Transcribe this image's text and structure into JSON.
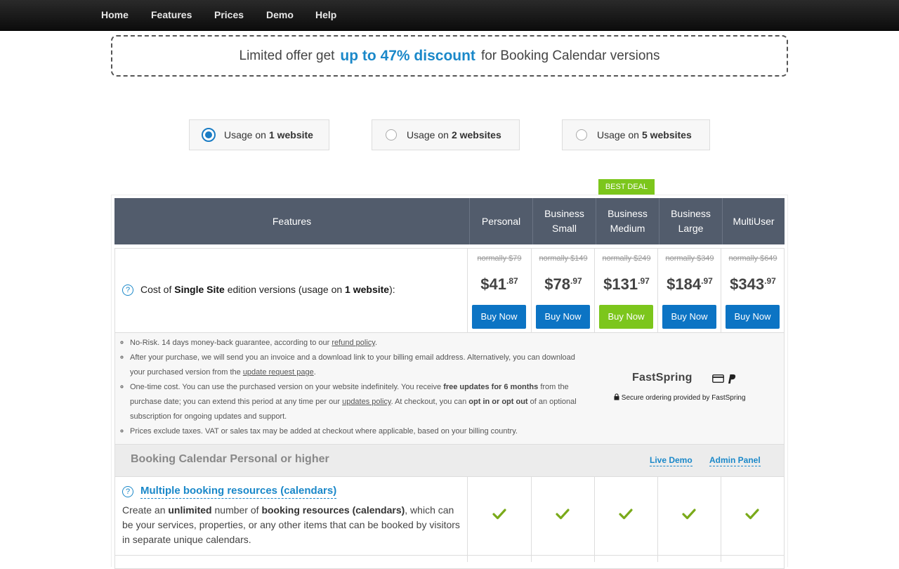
{
  "nav": {
    "items": [
      "Home",
      "Features",
      "Prices",
      "Demo",
      "Help"
    ]
  },
  "promo": {
    "prefix": "Limited offer get",
    "highlight": "up to 47% discount",
    "suffix": "for Booking Calendar versions"
  },
  "usage": {
    "options": [
      {
        "prefix": "Usage on",
        "bold": "1 website",
        "selected": true
      },
      {
        "prefix": "Usage on",
        "bold": "2 websites",
        "selected": false
      },
      {
        "prefix": "Usage on",
        "bold": "5 websites",
        "selected": false
      }
    ]
  },
  "badge": "BEST DEAL",
  "table": {
    "headers": {
      "features": "Features",
      "personal": "Personal",
      "business_small": "Business Small",
      "business_medium": "Business Medium",
      "business_large": "Business Large",
      "multiuser": "MultiUser"
    },
    "cost": {
      "label_prefix": "Cost of",
      "label_bold1": "Single Site",
      "label_mid": "edition versions (usage on",
      "label_bold2": "1 website",
      "label_suffix": "):",
      "plans": [
        {
          "normally": "normally $79",
          "dollars": "$41",
          "cents": ".87",
          "buy": "Buy Now"
        },
        {
          "normally": "normally $149",
          "dollars": "$78",
          "cents": ".97",
          "buy": "Buy Now"
        },
        {
          "normally": "normally $249",
          "dollars": "$131",
          "cents": ".97",
          "buy": "Buy Now"
        },
        {
          "normally": "normally $349",
          "dollars": "$184",
          "cents": ".97",
          "buy": "Buy Now"
        },
        {
          "normally": "normally $649",
          "dollars": "$343",
          "cents": ".97",
          "buy": "Buy Now"
        }
      ]
    },
    "info": {
      "item1_text": "No-Risk. 14 days money-back guarantee, according to our",
      "item1_link": "refund policy",
      "item2_text": "After your purchase, we will send you an invoice and a download link to your billing email address. Alternatively, you can download your purchased version from the",
      "item2_link": "update request page",
      "item3_a": "One-time cost. You can use the purchased version on your website indefinitely. You receive",
      "item3_bold1": "free updates for 6 months",
      "item3_b": "from the purchase date; you can extend this period at any time per our",
      "item3_link": "updates policy",
      "item3_c": ". At checkout, you can",
      "item3_bold2": "opt in or opt out",
      "item3_d": "of an optional subscription for ongoing updates and support.",
      "item4_text": "Prices exclude taxes. VAT or sales tax may be added at checkout where applicable, based on your billing country.",
      "fastspring": "FastSpring",
      "secure": "Secure ordering provided by FastSpring"
    },
    "section": {
      "title": "Booking Calendar Personal or higher",
      "live_demo": "Live Demo",
      "admin_panel": "Admin Panel"
    },
    "feature": {
      "title": "Multiple booking resources (calendars)",
      "desc_a": "Create an",
      "desc_bold1": "unlimited",
      "desc_b": "number of",
      "desc_bold2": "booking resources (calendars)",
      "desc_c": ", which can be your services, properties, or any other items that can be booked by visitors in separate unique calendars."
    }
  },
  "colors": {
    "accent": "#1a88c9",
    "header_bg": "#525c6c",
    "buy_blue": "#0c74c4",
    "best_green": "#7cc61c",
    "check_green": "#7aaa1a"
  }
}
